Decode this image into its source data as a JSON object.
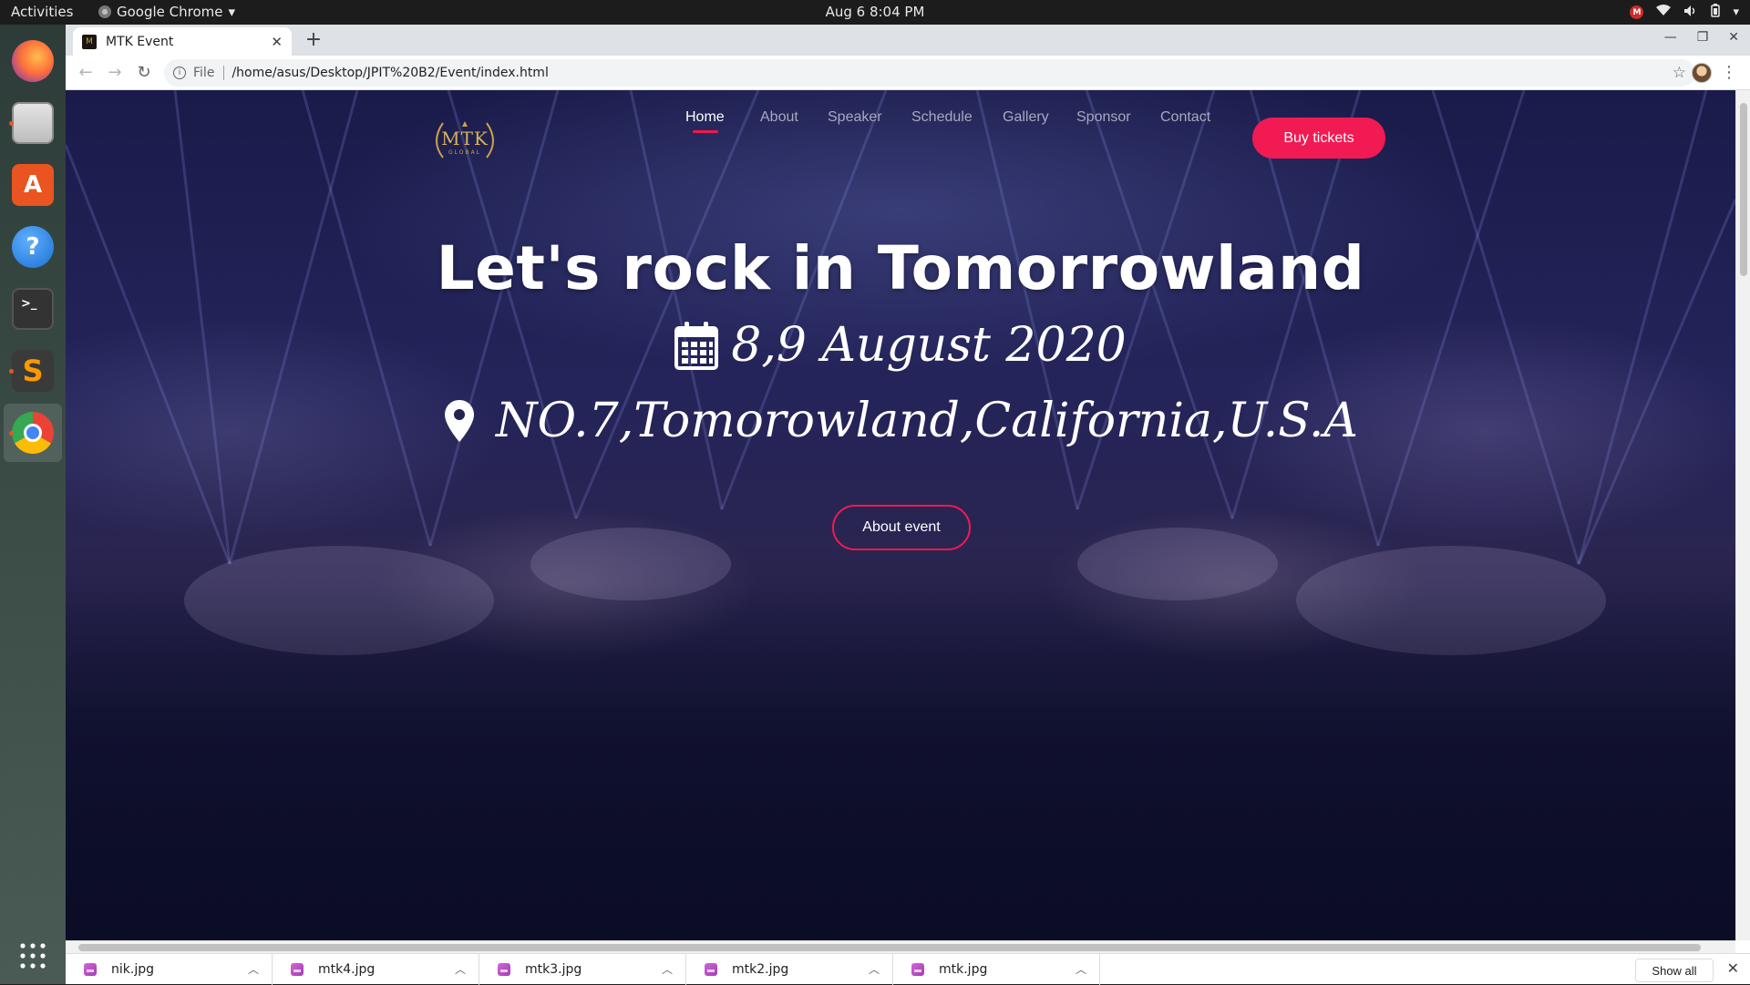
{
  "system": {
    "activities": "Activities",
    "app_menu": "Google Chrome",
    "clock": "Aug 6  8:04 PM",
    "tray_badge": "M"
  },
  "dock": {
    "items": [
      {
        "name": "Firefox",
        "icon": "firefox-icon"
      },
      {
        "name": "Files",
        "icon": "files-icon"
      },
      {
        "name": "Ubuntu Software",
        "icon": "software-icon"
      },
      {
        "name": "Help",
        "icon": "help-icon"
      },
      {
        "name": "Terminal",
        "icon": "terminal-icon"
      },
      {
        "name": "Sublime Text",
        "icon": "sublime-icon"
      },
      {
        "name": "Google Chrome",
        "icon": "chrome-icon"
      }
    ],
    "apps_grid_icon": "apps-grid-icon"
  },
  "browser": {
    "tab_title": "MTK Event",
    "url_scheme": "File",
    "url": "/home/asus/Desktop/JPIT%20B2/Event/index.html"
  },
  "site": {
    "logo_text": "MTK",
    "logo_sub": "GLOBAL",
    "nav": [
      "Home",
      "About",
      "Speaker",
      "Schedule",
      "Gallery",
      "Sponsor",
      "Contact"
    ],
    "active_nav": "Home",
    "buy_label": "Buy tickets",
    "hero_title": "Let's rock in Tomorrowland",
    "hero_date": "8,9 August 2020",
    "hero_place": "NO.7,Tomorowland,California,U.S.A",
    "about_event_label": "About event",
    "accent_color": "#f21a52"
  },
  "downloads": {
    "items": [
      "nik.jpg",
      "mtk4.jpg",
      "mtk3.jpg",
      "mtk2.jpg",
      "mtk.jpg"
    ],
    "show_all": "Show all"
  }
}
